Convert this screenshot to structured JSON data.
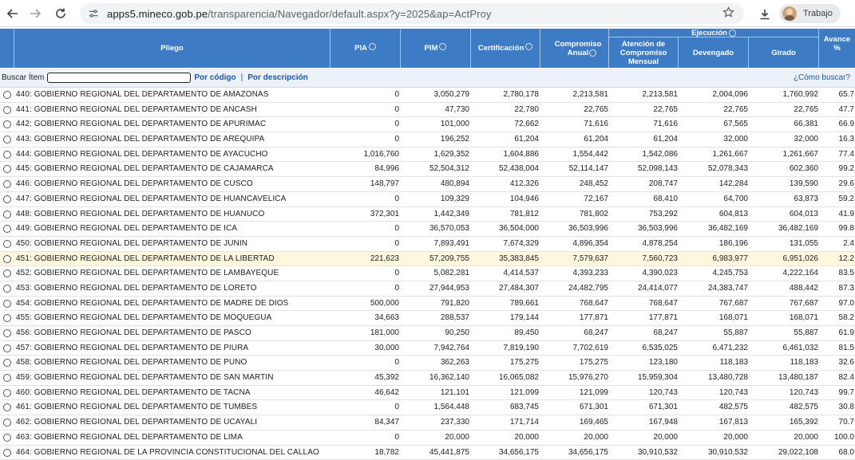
{
  "browser": {
    "url_host": "apps5.mineco.gob.pe",
    "url_path": "/transparencia/Navegador/default.aspx?y=2025&ap=ActProy",
    "profile_label": "Trabajo"
  },
  "table": {
    "headers": {
      "pliego": "Pliego",
      "pia": "PIA",
      "pim": "PIM",
      "certificacion": "Certificación",
      "compromiso_anual": "Compromiso Anual",
      "ejecucion": "Ejecución",
      "atencion": "Atención de Compromiso Mensual",
      "devengado": "Devengado",
      "girado": "Girado",
      "avance": "Avance %"
    },
    "search": {
      "label": "Buscar Ítem",
      "value": "",
      "por_codigo": "Por código",
      "separator": "|",
      "por_descripcion": "Por descripción",
      "help": "¿Cómo buscar?"
    },
    "rows": [
      {
        "name": "440: GOBIERNO REGIONAL DEL DEPARTAMENTO DE AMAZONAS",
        "pia": "0",
        "pim": "3,050,279",
        "cert": "2,780,178",
        "comp": "2,213,581",
        "aten": "2,213,581",
        "dev": "2,004,096",
        "gir": "1,760,992",
        "av": "65.7"
      },
      {
        "name": "441: GOBIERNO REGIONAL DEL DEPARTAMENTO DE ANCASH",
        "pia": "0",
        "pim": "47,730",
        "cert": "22,780",
        "comp": "22,765",
        "aten": "22,765",
        "dev": "22,765",
        "gir": "22,765",
        "av": "47.7"
      },
      {
        "name": "442: GOBIERNO REGIONAL DEL DEPARTAMENTO DE APURIMAC",
        "pia": "0",
        "pim": "101,000",
        "cert": "72,662",
        "comp": "71,616",
        "aten": "71,616",
        "dev": "67,565",
        "gir": "66,381",
        "av": "66.9"
      },
      {
        "name": "443: GOBIERNO REGIONAL DEL DEPARTAMENTO DE AREQUIPA",
        "pia": "0",
        "pim": "196,252",
        "cert": "61,204",
        "comp": "61,204",
        "aten": "61,204",
        "dev": "32,000",
        "gir": "32,000",
        "av": "16.3"
      },
      {
        "name": "444: GOBIERNO REGIONAL DEL DEPARTAMENTO DE AYACUCHO",
        "pia": "1,016,760",
        "pim": "1,629,352",
        "cert": "1,604,886",
        "comp": "1,554,442",
        "aten": "1,542,086",
        "dev": "1,261,667",
        "gir": "1,261,667",
        "av": "77.4"
      },
      {
        "name": "445: GOBIERNO REGIONAL DEL DEPARTAMENTO DE CAJAMARCA",
        "pia": "84,996",
        "pim": "52,504,312",
        "cert": "52,438,004",
        "comp": "52,114,147",
        "aten": "52,098,143",
        "dev": "52,078,343",
        "gir": "602,360",
        "av": "99.2"
      },
      {
        "name": "446: GOBIERNO REGIONAL DEL DEPARTAMENTO DE CUSCO",
        "pia": "148,797",
        "pim": "480,894",
        "cert": "412,326",
        "comp": "248,452",
        "aten": "208,747",
        "dev": "142,284",
        "gir": "139,590",
        "av": "29.6"
      },
      {
        "name": "447: GOBIERNO REGIONAL DEL DEPARTAMENTO DE HUANCAVELICA",
        "pia": "0",
        "pim": "109,329",
        "cert": "104,946",
        "comp": "72,167",
        "aten": "68,410",
        "dev": "64,700",
        "gir": "63,873",
        "av": "59.2"
      },
      {
        "name": "448: GOBIERNO REGIONAL DEL DEPARTAMENTO DE HUANUCO",
        "pia": "372,301",
        "pim": "1,442,349",
        "cert": "781,812",
        "comp": "781,802",
        "aten": "753,292",
        "dev": "604,813",
        "gir": "604,013",
        "av": "41.9"
      },
      {
        "name": "449: GOBIERNO REGIONAL DEL DEPARTAMENTO DE ICA",
        "pia": "0",
        "pim": "36,570,053",
        "cert": "36,504,000",
        "comp": "36,503,996",
        "aten": "36,503,996",
        "dev": "36,482,169",
        "gir": "36,482,169",
        "av": "99.8"
      },
      {
        "name": "450: GOBIERNO REGIONAL DEL DEPARTAMENTO DE JUNIN",
        "pia": "0",
        "pim": "7,893,491",
        "cert": "7,674,329",
        "comp": "4,896,354",
        "aten": "4,878,254",
        "dev": "186,196",
        "gir": "131,055",
        "av": "2.4"
      },
      {
        "name": "451: GOBIERNO REGIONAL DEL DEPARTAMENTO DE LA LIBERTAD",
        "pia": "221,623",
        "pim": "57,209,755",
        "cert": "35,383,845",
        "comp": "7,579,637",
        "aten": "7,560,723",
        "dev": "6,983,977",
        "gir": "6,951,026",
        "av": "12.2",
        "hl": true
      },
      {
        "name": "452: GOBIERNO REGIONAL DEL DEPARTAMENTO DE LAMBAYEQUE",
        "pia": "0",
        "pim": "5,082,281",
        "cert": "4,414,537",
        "comp": "4,393,233",
        "aten": "4,390,023",
        "dev": "4,245,753",
        "gir": "4,222,164",
        "av": "83.5"
      },
      {
        "name": "453: GOBIERNO REGIONAL DEL DEPARTAMENTO DE LORETO",
        "pia": "0",
        "pim": "27,944,953",
        "cert": "27,484,307",
        "comp": "24,482,795",
        "aten": "24,414,077",
        "dev": "24,383,747",
        "gir": "488,442",
        "av": "87.3"
      },
      {
        "name": "454: GOBIERNO REGIONAL DEL DEPARTAMENTO DE MADRE DE DIOS",
        "pia": "500,000",
        "pim": "791,820",
        "cert": "789,661",
        "comp": "768,647",
        "aten": "768,647",
        "dev": "767,687",
        "gir": "767,687",
        "av": "97.0"
      },
      {
        "name": "455: GOBIERNO REGIONAL DEL DEPARTAMENTO DE MOQUEGUA",
        "pia": "34,663",
        "pim": "288,537",
        "cert": "179,144",
        "comp": "177,871",
        "aten": "177,871",
        "dev": "168,071",
        "gir": "168,071",
        "av": "58.2"
      },
      {
        "name": "456: GOBIERNO REGIONAL DEL DEPARTAMENTO DE PASCO",
        "pia": "181,000",
        "pim": "90,250",
        "cert": "89,450",
        "comp": "68,247",
        "aten": "68,247",
        "dev": "55,887",
        "gir": "55,887",
        "av": "61.9"
      },
      {
        "name": "457: GOBIERNO REGIONAL DEL DEPARTAMENTO DE PIURA",
        "pia": "30,000",
        "pim": "7,942,764",
        "cert": "7,819,190",
        "comp": "7,702,619",
        "aten": "6,535,025",
        "dev": "6,471,232",
        "gir": "6,461,032",
        "av": "81.5"
      },
      {
        "name": "458: GOBIERNO REGIONAL DEL DEPARTAMENTO DE PUNO",
        "pia": "0",
        "pim": "362,263",
        "cert": "175,275",
        "comp": "175,275",
        "aten": "123,180",
        "dev": "118,183",
        "gir": "118,183",
        "av": "32.6"
      },
      {
        "name": "459: GOBIERNO REGIONAL DEL DEPARTAMENTO DE SAN MARTIN",
        "pia": "45,392",
        "pim": "16,362,140",
        "cert": "16,065,082",
        "comp": "15,976,270",
        "aten": "15,959,304",
        "dev": "13,480,728",
        "gir": "13,480,187",
        "av": "82.4"
      },
      {
        "name": "460: GOBIERNO REGIONAL DEL DEPARTAMENTO DE TACNA",
        "pia": "46,642",
        "pim": "121,101",
        "cert": "121,099",
        "comp": "121,099",
        "aten": "120,743",
        "dev": "120,743",
        "gir": "120,743",
        "av": "99.7"
      },
      {
        "name": "461: GOBIERNO REGIONAL DEL DEPARTAMENTO DE TUMBES",
        "pia": "0",
        "pim": "1,564,448",
        "cert": "683,745",
        "comp": "671,301",
        "aten": "671,301",
        "dev": "482,575",
        "gir": "482,575",
        "av": "30.8"
      },
      {
        "name": "462: GOBIERNO REGIONAL DEL DEPARTAMENTO DE UCAYALI",
        "pia": "84,347",
        "pim": "237,330",
        "cert": "171,714",
        "comp": "169,465",
        "aten": "167,948",
        "dev": "167,813",
        "gir": "165,392",
        "av": "70.7"
      },
      {
        "name": "463: GOBIERNO REGIONAL DEL DEPARTAMENTO DE LIMA",
        "pia": "0",
        "pim": "20,000",
        "cert": "20,000",
        "comp": "20,000",
        "aten": "20,000",
        "dev": "20,000",
        "gir": "20,000",
        "av": "100.0"
      },
      {
        "name": "464: GOBIERNO REGIONAL DE LA PROVINCIA CONSTITUCIONAL DEL CALLAO",
        "pia": "18,782",
        "pim": "45,441,875",
        "cert": "34,656,175",
        "comp": "34,656,175",
        "aten": "30,910,532",
        "dev": "30,910,532",
        "gir": "29,022,108",
        "av": "68.0"
      }
    ]
  }
}
